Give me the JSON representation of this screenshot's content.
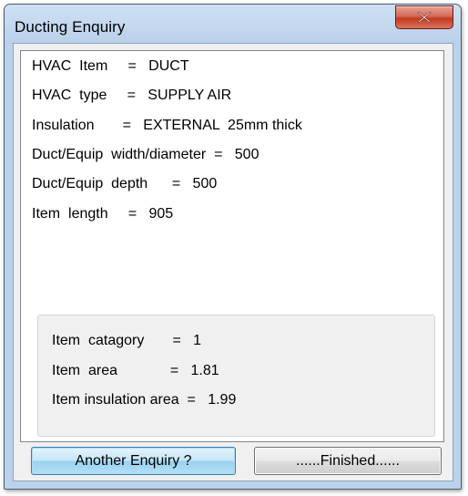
{
  "window": {
    "title": "Ducting Enquiry"
  },
  "info": {
    "lines": [
      "HVAC  Item     =   DUCT",
      "HVAC  type     =   SUPPLY AIR",
      "Insulation       =   EXTERNAL  25mm thick",
      "Duct/Equip  width/diameter  =   500",
      "Duct/Equip  depth      =   500",
      "Item  length     =   905"
    ]
  },
  "summary": {
    "lines": [
      "Item  catagory       =   1",
      "Item  area             =   1.81",
      "Item insulation area  =   1.99"
    ]
  },
  "buttons": {
    "another": "Another Enquiry ?",
    "finished": "......Finished......"
  },
  "icons": {
    "close": "close-icon"
  },
  "colors": {
    "titlebar": "#bcd2ea",
    "close_button": "#c23b21",
    "default_button": "#98d1ef"
  }
}
